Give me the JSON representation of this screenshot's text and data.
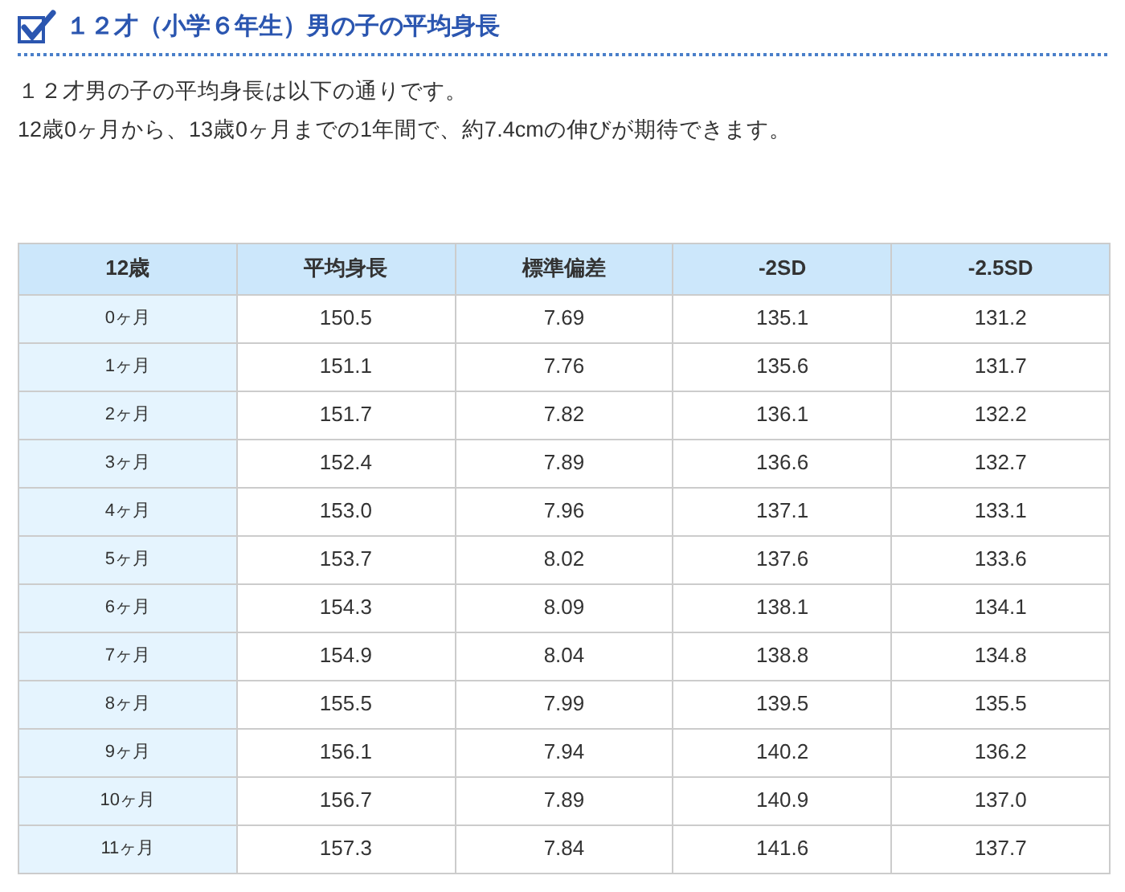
{
  "heading": "１２才（小学６年生）男の子の平均身長",
  "intro": [
    "１２才男の子の平均身長は以下の通りです。",
    "12歳0ヶ月から、13歳0ヶ月までの1年間で、約7.4cmの伸びが期待できます。"
  ],
  "table": {
    "columns": [
      "12歳",
      "平均身長",
      "標準偏差",
      "-2SD",
      "-2.5SD"
    ],
    "rows": [
      [
        "0ヶ月",
        "150.5",
        "7.69",
        "135.1",
        "131.2"
      ],
      [
        "1ヶ月",
        "151.1",
        "7.76",
        "135.6",
        "131.7"
      ],
      [
        "2ヶ月",
        "151.7",
        "7.82",
        "136.1",
        "132.2"
      ],
      [
        "3ヶ月",
        "152.4",
        "7.89",
        "136.6",
        "132.7"
      ],
      [
        "4ヶ月",
        "153.0",
        "7.96",
        "137.1",
        "133.1"
      ],
      [
        "5ヶ月",
        "153.7",
        "8.02",
        "137.6",
        "133.6"
      ],
      [
        "6ヶ月",
        "154.3",
        "8.09",
        "138.1",
        "134.1"
      ],
      [
        "7ヶ月",
        "154.9",
        "8.04",
        "138.8",
        "134.8"
      ],
      [
        "8ヶ月",
        "155.5",
        "7.99",
        "139.5",
        "135.5"
      ],
      [
        "9ヶ月",
        "156.1",
        "7.94",
        "140.2",
        "136.2"
      ],
      [
        "10ヶ月",
        "156.7",
        "7.89",
        "140.9",
        "137.0"
      ],
      [
        "11ヶ月",
        "157.3",
        "7.84",
        "141.6",
        "137.7"
      ]
    ]
  }
}
